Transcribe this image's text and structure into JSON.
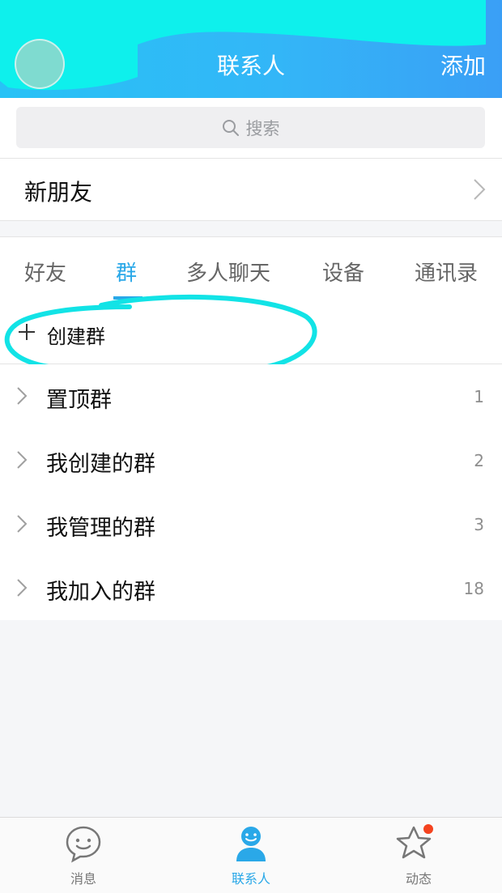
{
  "header": {
    "title": "联系人",
    "add_label": "添加",
    "accent": "#2aa8e8"
  },
  "search": {
    "placeholder": "搜索"
  },
  "new_friends": {
    "label": "新朋友"
  },
  "tabs": [
    {
      "label": "好友",
      "active": false
    },
    {
      "label": "群",
      "active": true
    },
    {
      "label": "多人聊天",
      "active": false
    },
    {
      "label": "设备",
      "active": false
    },
    {
      "label": "通讯录",
      "active": false
    }
  ],
  "create_group": {
    "label": "创建群"
  },
  "groups": [
    {
      "name": "置顶群",
      "count": "1"
    },
    {
      "name": "我创建的群",
      "count": "2"
    },
    {
      "name": "我管理的群",
      "count": "3"
    },
    {
      "name": "我加入的群",
      "count": "18"
    }
  ],
  "bottom_nav": [
    {
      "label": "消息",
      "icon": "message-icon",
      "active": false
    },
    {
      "label": "联系人",
      "icon": "contacts-icon",
      "active": true
    },
    {
      "label": "动态",
      "icon": "star-icon",
      "active": false,
      "badge": true
    }
  ]
}
